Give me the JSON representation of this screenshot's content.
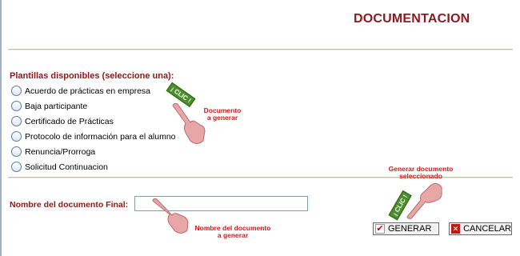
{
  "page": {
    "title": "DOCUMENTACION"
  },
  "templates": {
    "label": "Plantillas disponibles (seleccione una):",
    "options": [
      "Acuerdo de prácticas en empresa",
      "Baja participante",
      "Certificado de Prácticas",
      "Protocolo de información para el alumno",
      "Renuncia/Prorroga",
      "Solicitud Continuacion"
    ]
  },
  "final_name": {
    "label": "Nombre del documento Final:",
    "value": "",
    "placeholder": ""
  },
  "buttons": {
    "generate": "GENERAR",
    "cancel": "CANCELAR"
  },
  "annotations": {
    "clic": "¡ CLIC !",
    "documento_a_generar": [
      "Documento",
      "a generar"
    ],
    "nombre_documento": [
      "Nombre del documento",
      "a generar"
    ],
    "generar_seleccionado": [
      "Generar documento",
      "seleccionado"
    ]
  },
  "colors": {
    "accent": "#8b1a1a",
    "annotation": "#d51a1a",
    "hand": "#e8a7a7"
  },
  "icons": {
    "generate": "check-icon",
    "cancel": "x-icon",
    "pointer": "pointing-hand-icon"
  }
}
